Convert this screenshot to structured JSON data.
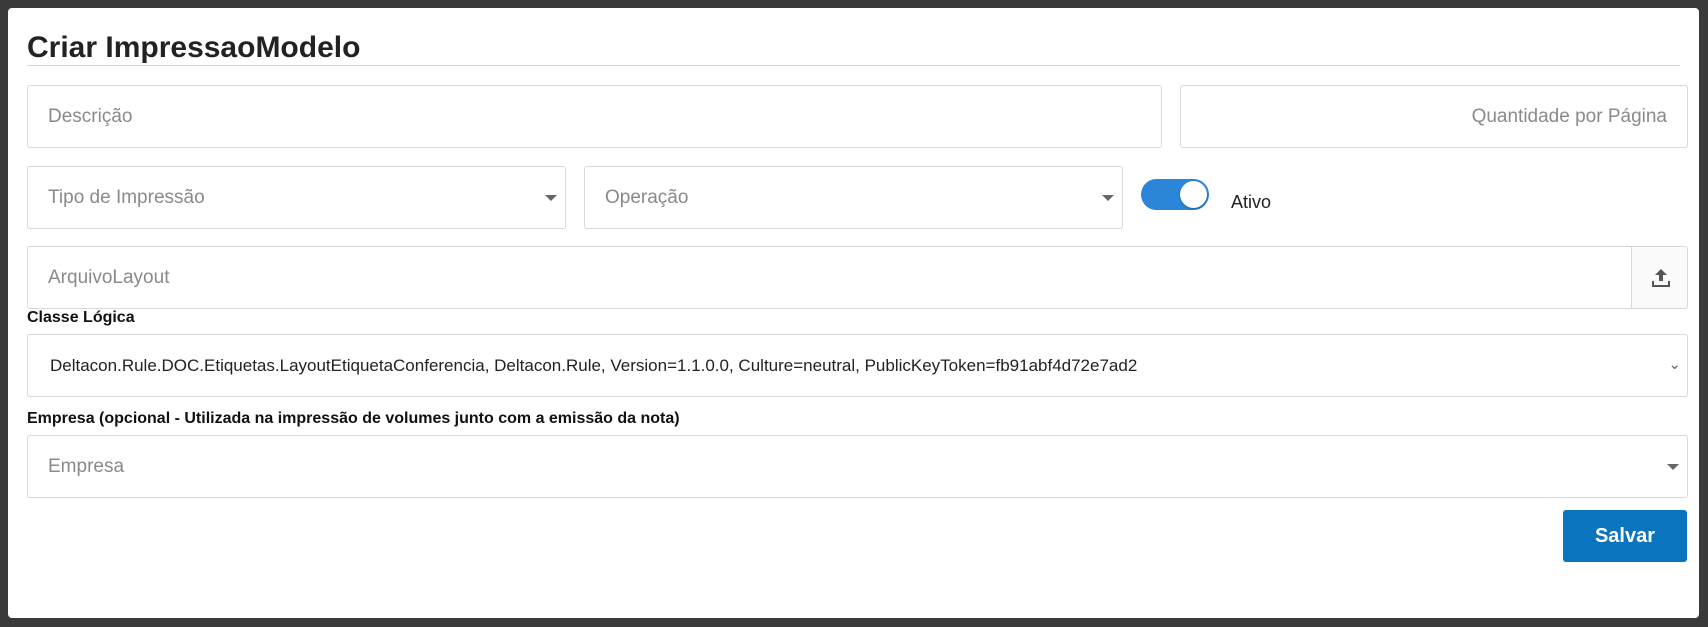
{
  "form": {
    "title": "Criar ImpressaoModelo",
    "descricao": {
      "placeholder": "Descrição"
    },
    "quantidade": {
      "placeholder": "Quantidade por Página"
    },
    "tipo_impressao": {
      "placeholder": "Tipo de Impressão"
    },
    "operacao": {
      "placeholder": "Operação"
    },
    "ativo": {
      "label": "Ativo",
      "checked": true
    },
    "arquivo_layout": {
      "placeholder": "ArquivoLayout",
      "button_icon": "upload-icon"
    },
    "classe_logica": {
      "label": "Classe Lógica",
      "selected": "Deltacon.Rule.DOC.Etiquetas.LayoutEtiquetaConferencia, Deltacon.Rule, Version=1.1.0.0, Culture=neutral, PublicKeyToken=fb91abf4d72e7ad2"
    },
    "empresa": {
      "label": "Empresa (opcional - Utilizada na impressão de volumes junto com a emissão da nota)",
      "placeholder": "Empresa"
    },
    "save_label": "Salvar"
  },
  "colors": {
    "accent": "#2b85d8",
    "primary_button": "#0a74bf",
    "border": "#d8d8d8",
    "backdrop": "#3a3a3a"
  }
}
